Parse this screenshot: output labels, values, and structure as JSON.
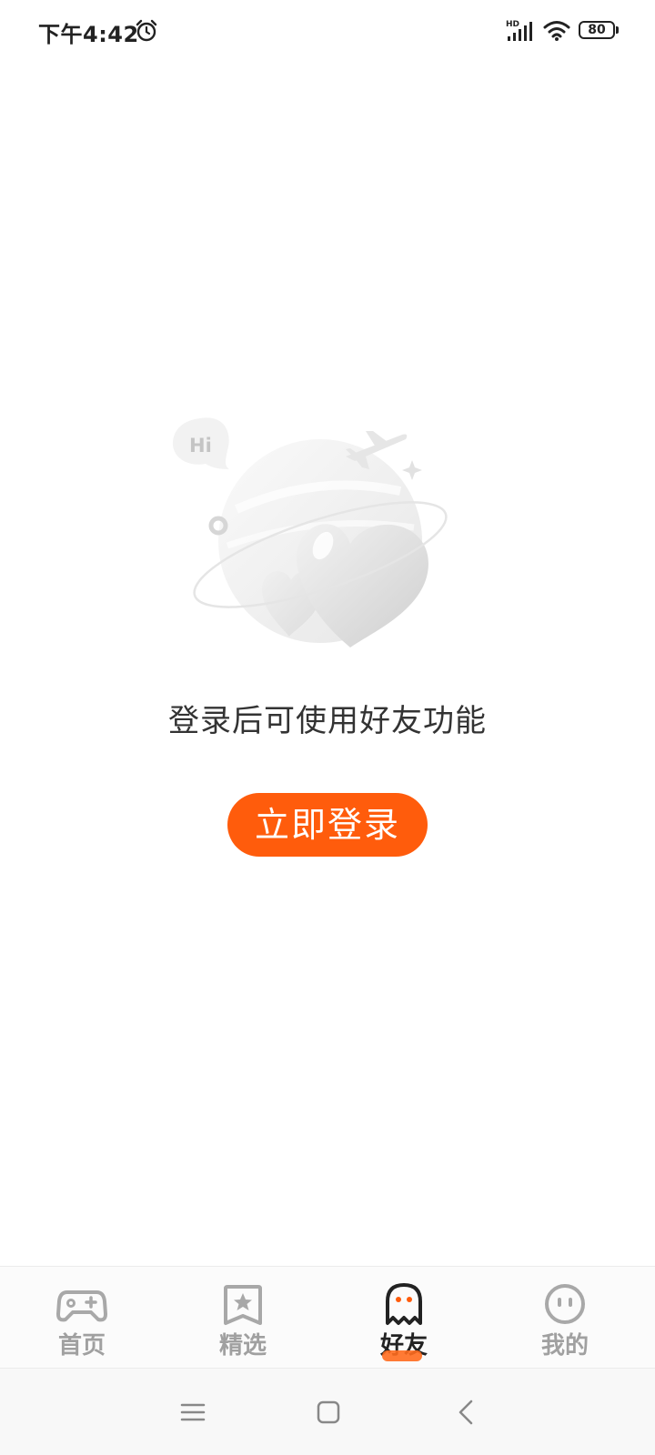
{
  "status_bar": {
    "time": "下午4:42",
    "network_label": "HD",
    "battery": "80",
    "icons": [
      "alarm-icon",
      "signal-icon",
      "wifi-icon",
      "battery-icon"
    ]
  },
  "main": {
    "illustration_text": "Hi",
    "prompt": "登录后可使用好友功能",
    "login_button": "立即登录"
  },
  "tab_bar": {
    "active": "friends",
    "items": [
      {
        "key": "home",
        "label": "首页",
        "icon": "gamepad-icon"
      },
      {
        "key": "featured",
        "label": "精选",
        "icon": "star-bookmark-icon"
      },
      {
        "key": "friends",
        "label": "好友",
        "icon": "ghost-icon"
      },
      {
        "key": "mine",
        "label": "我的",
        "icon": "face-icon"
      }
    ]
  },
  "nav_bar": {
    "icons": [
      "menu-icon",
      "home-square-icon",
      "back-icon"
    ]
  },
  "colors": {
    "accent": "#ff5c0c",
    "tab_inactive": "#a0a0a0",
    "tab_active": "#222222",
    "text": "#333333"
  }
}
